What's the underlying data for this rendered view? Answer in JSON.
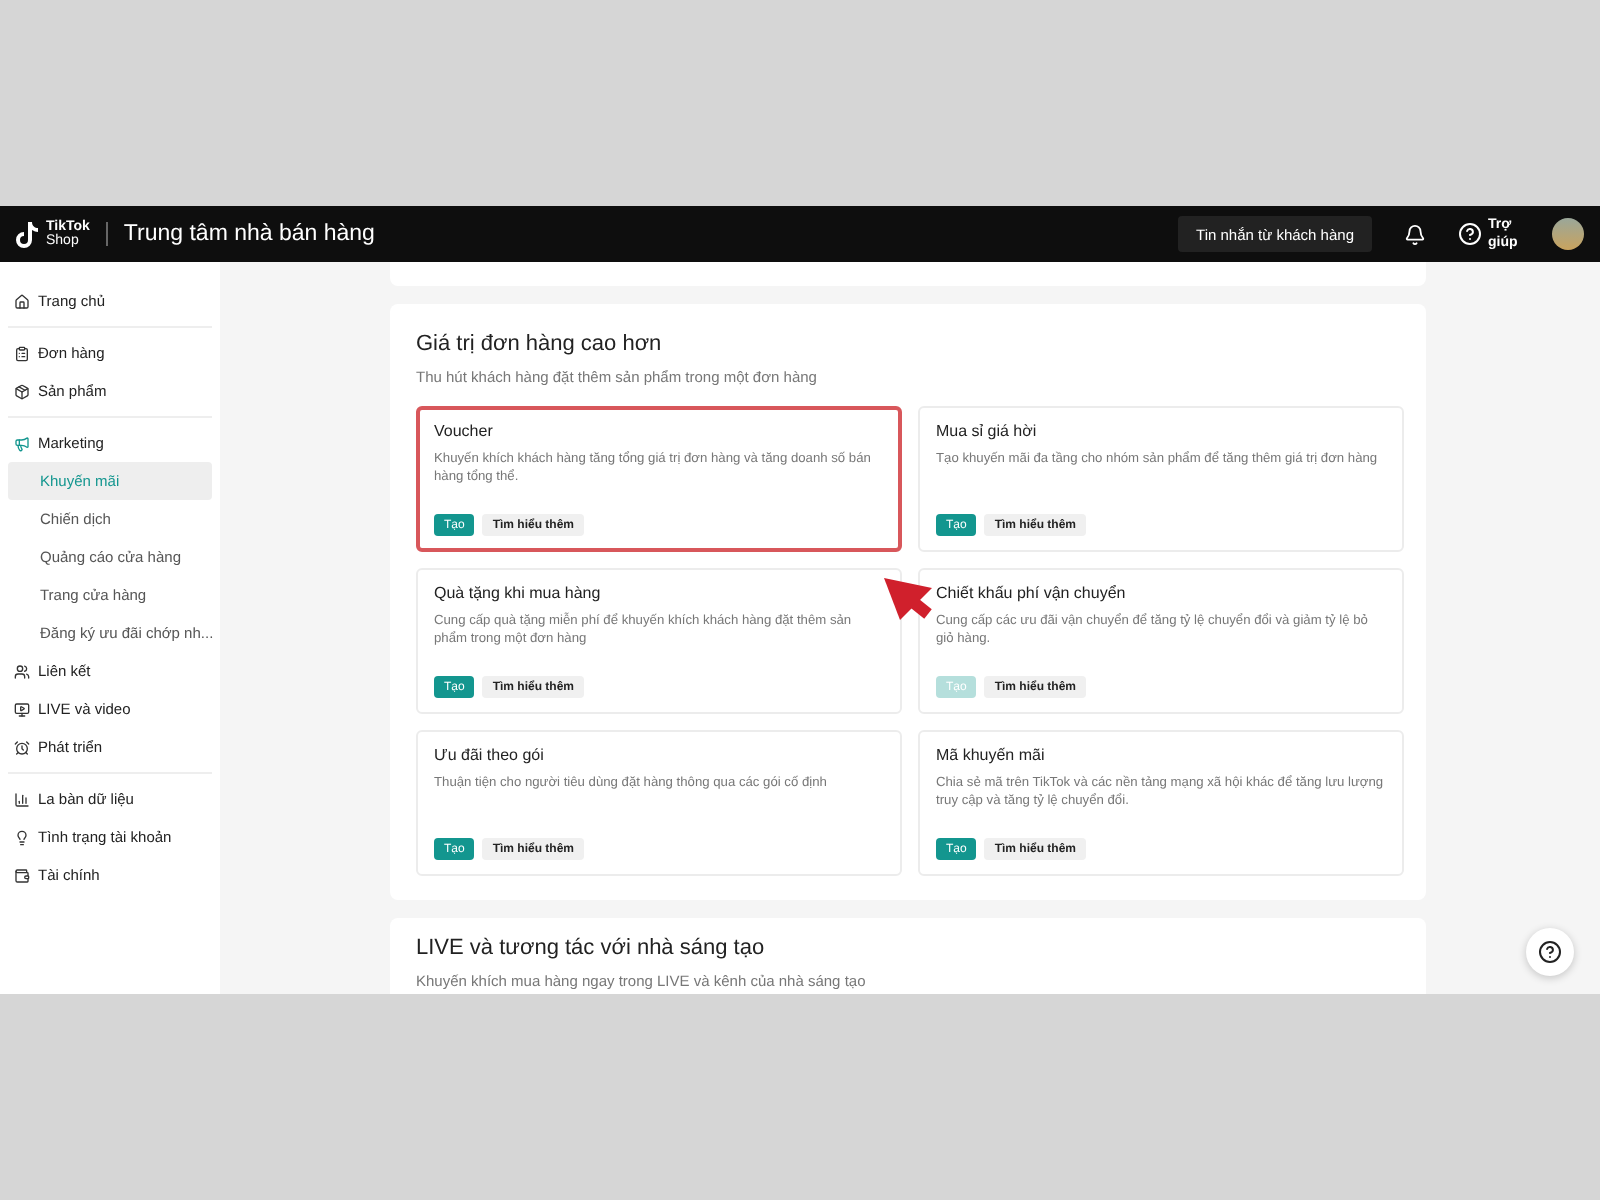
{
  "header": {
    "logo_top": "TikTok",
    "logo_bottom": "Shop",
    "title": "Trung tâm nhà bán hàng",
    "message_button": "Tin nhắn từ khách hàng",
    "help_label": "Trợ giúp"
  },
  "sidebar": {
    "groups": [
      [
        {
          "label": "Trang chủ",
          "selected": false
        }
      ],
      [
        {
          "label": "Đơn hàng",
          "selected": false
        },
        {
          "label": "Sản phẩm",
          "selected": false
        }
      ],
      [
        {
          "label": "Marketing",
          "selected": false,
          "expanded": true,
          "children": [
            {
              "label": "Khuyến mãi",
              "selected": true
            },
            {
              "label": "Chiến dịch",
              "selected": false
            },
            {
              "label": "Quảng cáo cửa hàng",
              "selected": false
            },
            {
              "label": "Trang cửa hàng",
              "selected": false
            },
            {
              "label": "Đăng ký ưu đãi chớp nh...",
              "selected": false
            }
          ]
        },
        {
          "label": "Liên kết",
          "selected": false
        },
        {
          "label": "LIVE và video",
          "selected": false
        },
        {
          "label": "Phát triển",
          "selected": false
        }
      ],
      [
        {
          "label": "La bàn dữ liệu",
          "selected": false
        },
        {
          "label": "Tình trạng tài khoản",
          "selected": false
        },
        {
          "label": "Tài chính",
          "selected": false
        }
      ]
    ]
  },
  "section": {
    "title": "Giá trị đơn hàng cao hơn",
    "subtitle": "Thu hút khách hàng đặt thêm sản phẩm trong một đơn hàng",
    "cards": [
      {
        "title": "Voucher",
        "description": "Khuyến khích khách hàng tăng tổng giá trị đơn hàng và tăng doanh số bán hàng tổng thể.",
        "create": "Tạo",
        "learn": "Tìm hiểu thêm",
        "selected": true,
        "disabled": false
      },
      {
        "title": "Mua sỉ giá hời",
        "description": "Tạo khuyến mãi đa tầng cho nhóm sản phẩm để tăng thêm giá trị đơn hàng",
        "create": "Tạo",
        "learn": "Tìm hiểu thêm",
        "selected": false,
        "disabled": false
      },
      {
        "title": "Quà tặng khi mua hàng",
        "description": "Cung cấp quà tặng miễn phí để khuyến khích khách hàng đặt thêm sản phẩm trong một đơn hàng",
        "create": "Tạo",
        "learn": "Tìm hiểu thêm",
        "selected": false,
        "disabled": false
      },
      {
        "title": "Chiết khấu phí vận chuyển",
        "description": "Cung cấp các ưu đãi vận chuyển để tăng tỷ lệ chuyển đổi và giảm tỷ lệ bỏ giỏ hàng.",
        "create": "Tạo",
        "learn": "Tìm hiểu thêm",
        "selected": false,
        "disabled": true
      },
      {
        "title": "Ưu đãi theo gói",
        "description": "Thuận tiện cho người tiêu dùng đặt hàng thông qua các gói cố định",
        "create": "Tạo",
        "learn": "Tìm hiểu thêm",
        "selected": false,
        "disabled": false
      },
      {
        "title": "Mã khuyến mãi",
        "description": "Chia sẻ mã trên TikTok và các nền tảng mạng xã hội khác để tăng lưu lượng truy cập và tăng tỷ lệ chuyển đổi.",
        "create": "Tạo",
        "learn": "Tìm hiểu thêm",
        "selected": false,
        "disabled": false
      }
    ]
  },
  "next_section": {
    "title": "LIVE và tương tác với nhà sáng tạo",
    "subtitle": "Khuyến khích mua hàng ngay trong LIVE và kênh của nhà sáng tạo"
  }
}
